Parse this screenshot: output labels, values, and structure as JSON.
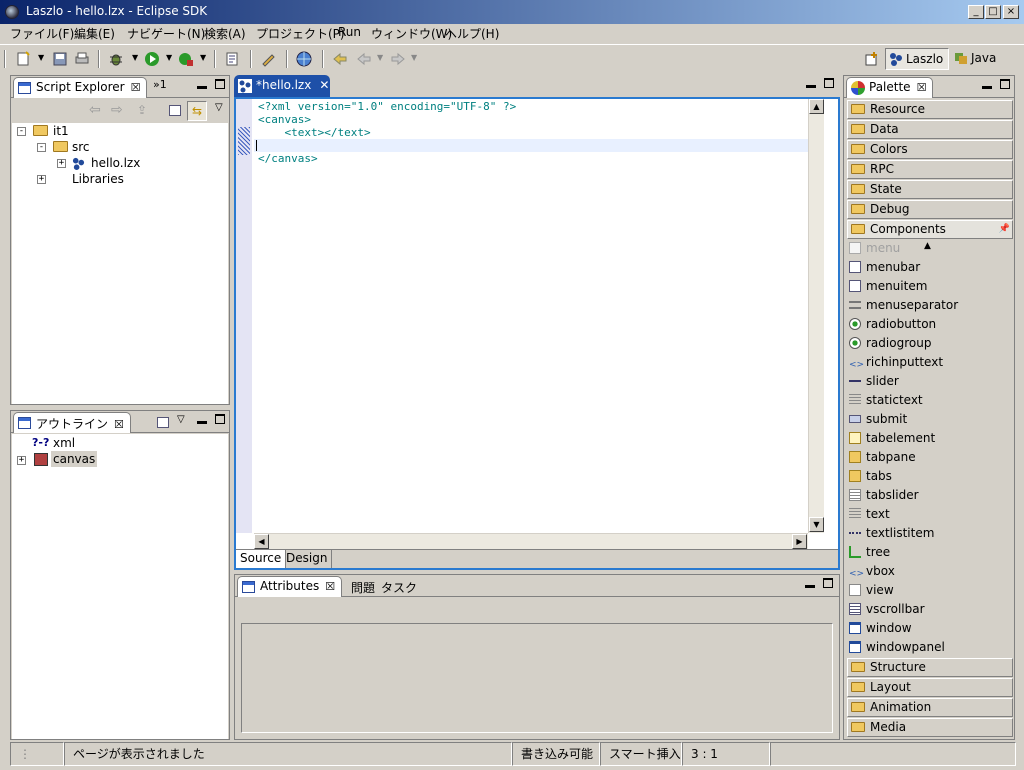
{
  "window": {
    "title": "Laszlo - hello.lzx - Eclipse SDK"
  },
  "menubar": [
    "ファイル(F)",
    "編集(E)",
    "ナビゲート(N)",
    "検索(A)",
    "プロジェクト(P)",
    "Run",
    "ウィンドウ(W)",
    "ヘルプ(H)"
  ],
  "perspectives": {
    "laszlo": "Laszlo",
    "java": "Java"
  },
  "script_explorer": {
    "title": "Script Explorer",
    "extra_tabs": "»1",
    "tree": {
      "project": "it1",
      "src": "src",
      "file": "hello.lzx",
      "libraries": "Libraries"
    }
  },
  "outline": {
    "title": "アウトライン",
    "items": [
      "xml",
      "canvas"
    ],
    "xml_icon": "?-?"
  },
  "editor": {
    "tab_label": "*hello.lzx",
    "lines": [
      "<?xml version=\"1.0\" encoding=\"UTF-8\" ?>",
      "<canvas>",
      "    <text></text>",
      "",
      "</canvas>"
    ],
    "bottom_tabs": [
      "Source",
      "Design"
    ]
  },
  "attributes": {
    "tabs": [
      "Attributes",
      "問題",
      "タスク"
    ]
  },
  "palette": {
    "title": "Palette",
    "drawers_top": [
      "Resource",
      "Data",
      "Colors",
      "RPC",
      "State",
      "Debug",
      "Components"
    ],
    "components": [
      "menu",
      "menubar",
      "menuitem",
      "menuseparator",
      "radiobutton",
      "radiogroup",
      "richinputtext",
      "slider",
      "statictext",
      "submit",
      "tabelement",
      "tabpane",
      "tabs",
      "tabslider",
      "text",
      "textlistitem",
      "tree",
      "vbox",
      "view",
      "vscrollbar",
      "window",
      "windowpanel"
    ],
    "drawers_bottom": [
      "Structure",
      "Layout",
      "Animation",
      "Media"
    ]
  },
  "statusbar": {
    "message": "ページが表示されました",
    "writable": "書き込み可能",
    "insert_mode": "スマート挿入",
    "position": "3 : 1"
  },
  "colors": {
    "title_active": "#0a246a",
    "editor_tab": "#1e50a8",
    "xml_text": "#008080",
    "editor_border": "#2a7ad0"
  }
}
